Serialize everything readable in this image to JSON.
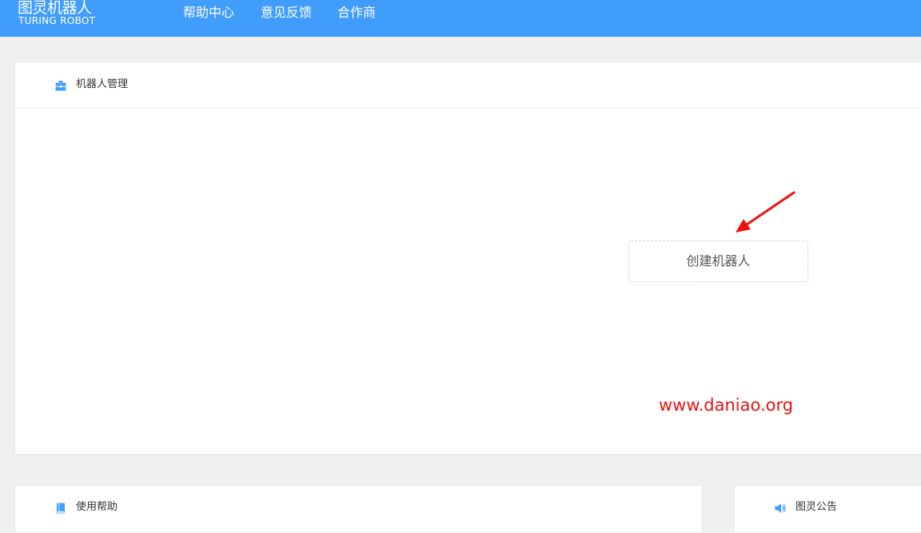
{
  "header": {
    "logo_cn": "图灵机器人",
    "logo_en": "TURING ROBOT",
    "nav": [
      "帮助中心",
      "意见反馈",
      "合作商"
    ]
  },
  "robot_panel": {
    "title": "机器人管理",
    "icon": "toolbox-icon",
    "create_label": "创建机器人"
  },
  "help_panel": {
    "title": "使用帮助",
    "icon": "book-icon"
  },
  "notice_panel": {
    "title": "图灵公告",
    "icon": "speaker-icon"
  },
  "watermark": "www.daniao.org",
  "colors": {
    "header_bg": "#419dfb",
    "accent": "#419dfb",
    "arrow": "#ee1111",
    "watermark": "#ee1111"
  }
}
